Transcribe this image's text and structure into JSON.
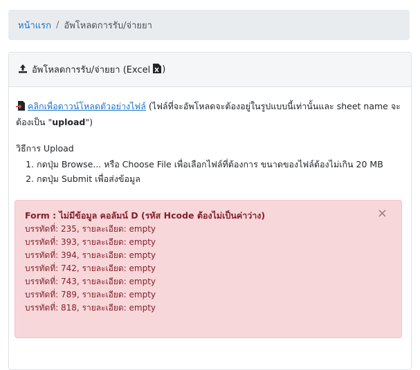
{
  "breadcrumb": {
    "home": "หน้าแรก",
    "separator": "/",
    "current": "อัพโหลดการรับ/จ่ายยา"
  },
  "card": {
    "header_title": "อัพโหลดการรับ/จ่ายยา (Excel",
    "header_close": ")",
    "download_link": "คลิกเพื่อดาวน์โหลดตัวอย่างไฟล์",
    "download_note_a": " (ไฟล์ที่จะอัพโหลดจะต้องอยู่ในรูปแบบนี้เท่านั้นและ sheet name จะต้องเป็น \"",
    "download_note_bold": "upload",
    "download_note_b": "\")",
    "steps_title": "วิธีการ Upload",
    "steps": [
      "กดปุ่ม Browse... หรือ Choose File เพื่อเลือกไฟล์ที่ต้องการ ขนาดของไฟล์ต้องไม่เกิน 20 MB",
      "กดปุ่ม Submit เพื่อส่งข้อมูล"
    ]
  },
  "alert": {
    "title": "Form : ไม่มีข้อมูล คอลัมน์ D (รหัส Hcode ต้องไม่เป็นค่าว่าง)",
    "close": "×",
    "rows": [
      "บรรทัดที่: 235, รายละเอียด: empty",
      "บรรทัดที่: 393, รายละเอียด: empty",
      "บรรทัดที่: 394, รายละเอียด: empty",
      "บรรทัดที่: 742, รายละเอียด: empty",
      "บรรทัดที่: 743, รายละเอียด: empty",
      "บรรทัดที่: 789, รายละเอียด: empty",
      "บรรทัดที่: 818, รายละเอียด: empty"
    ]
  },
  "colors": {
    "link": "#1a73c7",
    "alert_bg": "#f8d7da",
    "alert_text": "#842029"
  }
}
